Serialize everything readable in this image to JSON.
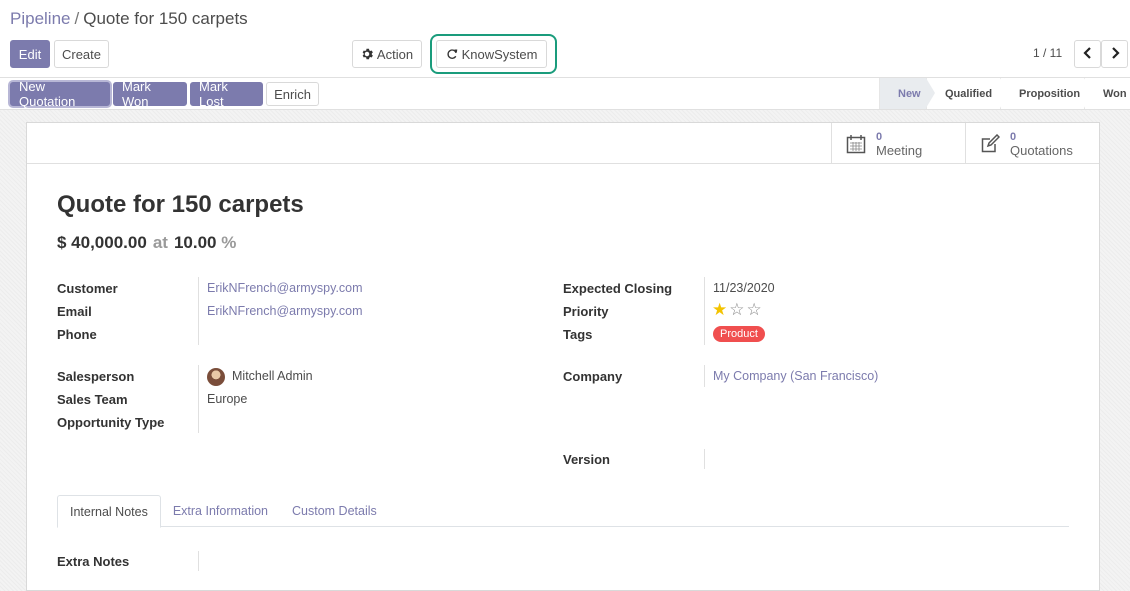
{
  "breadcrumb": {
    "parent": "Pipeline",
    "separator": "/",
    "current": "Quote for 150 carpets"
  },
  "toolbar": {
    "edit_label": "Edit",
    "create_label": "Create",
    "action_label": "Action",
    "action_icon": "gear-icon",
    "knowsystem_label": "KnowSystem",
    "knowsystem_icon": "refresh-icon"
  },
  "pager": {
    "value": "1 / 11",
    "prev_icon": "chevron-left-icon",
    "next_icon": "chevron-right-icon"
  },
  "statusbar": {
    "buttons": [
      "New Quotation",
      "Mark Won",
      "Mark Lost",
      "Enrich"
    ],
    "stages": [
      "New",
      "Qualified",
      "Proposition",
      "Won"
    ],
    "active_stage": "New"
  },
  "smart_buttons": [
    {
      "count": "0",
      "label": "Meeting",
      "icon": "calendar-icon"
    },
    {
      "count": "0",
      "label": "Quotations",
      "icon": "edit-icon"
    }
  ],
  "record": {
    "title": "Quote for 150 carpets",
    "revenue": "$ 40,000.00",
    "at_label": "at",
    "probability": "10.00",
    "percent_sign": "%"
  },
  "fields_left": {
    "customer_label": "Customer",
    "customer_value": "ErikNFrench@armyspy.com",
    "email_label": "Email",
    "email_value": "ErikNFrench@armyspy.com",
    "phone_label": "Phone",
    "phone_value": "",
    "salesperson_label": "Salesperson",
    "salesperson_value": "Mitchell Admin",
    "sales_team_label": "Sales Team",
    "sales_team_value": "Europe",
    "opportunity_type_label": "Opportunity Type",
    "opportunity_type_value": ""
  },
  "fields_right": {
    "expected_closing_label": "Expected Closing",
    "expected_closing_value": "11/23/2020",
    "priority_label": "Priority",
    "priority_stars": 1,
    "priority_max": 3,
    "tags_label": "Tags",
    "tag_value": "Product",
    "company_label": "Company",
    "company_value": "My Company (San Francisco)",
    "version_label": "Version",
    "version_value": ""
  },
  "colors": {
    "accent": "#7c7bad",
    "tag": "#f04f4f",
    "highlight": "#1a9c7c",
    "star": "#f3c300"
  },
  "tabs": [
    "Internal Notes",
    "Extra Information",
    "Custom Details"
  ],
  "active_tab": "Internal Notes",
  "notes": {
    "extra_notes_label": "Extra Notes",
    "extra_notes_value": ""
  }
}
